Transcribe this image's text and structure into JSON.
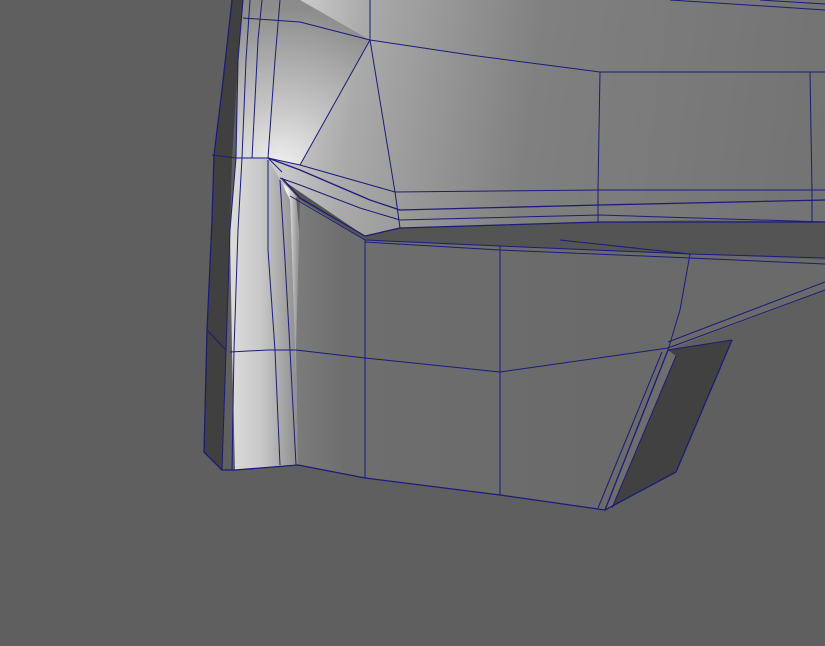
{
  "viewport": {
    "view": "3d-modeling-viewport",
    "display_mode": "wireframe-on-shaded",
    "object": "polygon-mesh",
    "colors": {
      "background": "#5f5f5f",
      "wireframe": "#1c1c78",
      "highlight": "#f4f4f4",
      "mid_face": "#8c8c8c",
      "face": "#6a6a6a",
      "dark_face": "#404040",
      "recess_face": "#525252"
    }
  }
}
